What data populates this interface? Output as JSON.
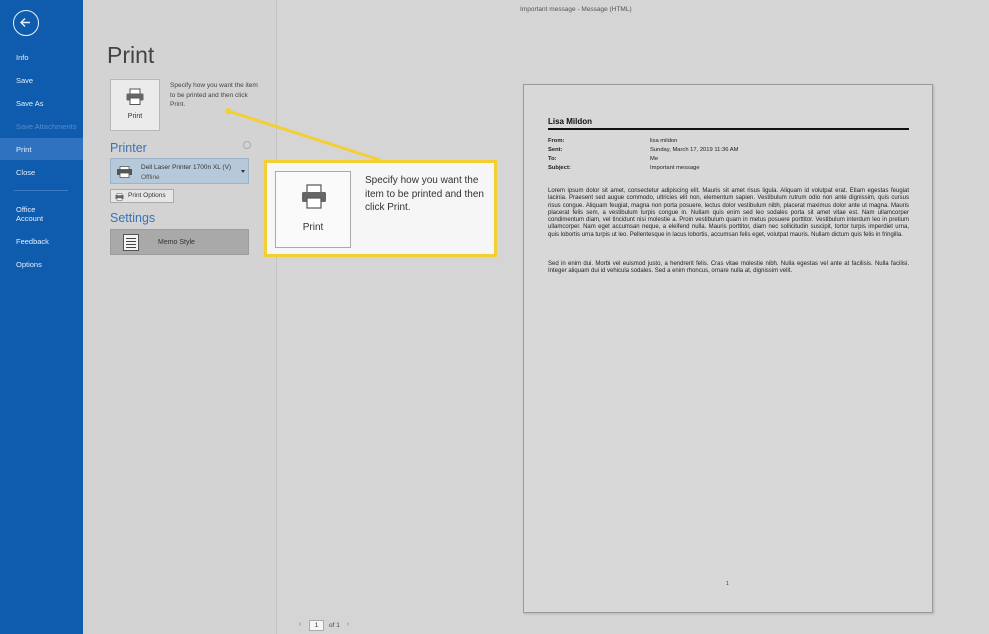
{
  "window": {
    "title": "Important message - Message (HTML)"
  },
  "sidebar": {
    "items": [
      {
        "label": "Info"
      },
      {
        "label": "Save"
      },
      {
        "label": "Save As"
      },
      {
        "label": "Save Attachments"
      },
      {
        "label": "Print"
      },
      {
        "label": "Close"
      },
      {
        "label": "Office Account"
      },
      {
        "label": "Feedback"
      },
      {
        "label": "Options"
      }
    ]
  },
  "print": {
    "title": "Print",
    "button_label": "Print",
    "description": "Specify how you want the item to be printed and then click Print."
  },
  "printer": {
    "heading": "Printer",
    "selected_name": "Dell Laser Printer 1700n XL (V)",
    "status": "Offline",
    "options_label": "Print Options"
  },
  "settings": {
    "heading": "Settings",
    "style_label": "Memo Style"
  },
  "preview": {
    "sender": "Lisa Mildon",
    "headers": [
      {
        "key": "From:",
        "value": "lisa mildon"
      },
      {
        "key": "Sent:",
        "value": "Sunday, March 17, 2019 11:36 AM"
      },
      {
        "key": "To:",
        "value": "Me"
      },
      {
        "key": "Subject:",
        "value": "Important message"
      }
    ],
    "body": [
      "Lorem ipsum dolor sit amet, consectetur adipiscing elit. Mauris sit amet risus ligula. Aliquam id volutpat erat. Etiam egestas feugiat lacinia. Praesent sed augue commodo, ultricies elit non, elementum sapien. Vestibulum rutrum odio non ante dignissim, quis cursus risus congue. Aliquam feugiat, magna non porta posuere, lectus dolor vestibulum nibh, placerat maximus dolor ante ut magna. Mauris placerat felis sem, a vestibulum turpis congue in. Nullam quis enim sed leo sodales porta sit amet vitae est. Nam ullamcorper condimentum diam, vel tincidunt nisi molestie a. Proin vestibulum quam in metus posuere porttitor. Vestibulum interdum leo in pretium ullamcorper. Nam eget accumsan neque, a eleifend nulla. Mauris porttitor, diam nec sollicitudin suscipit, tortor turpis imperdiet urna, quis lobortis urna turpis ut leo. Pellentesque in lacus lobortis, accumsan felis eget, volutpat mauris. Nullam dictum quis felis in fringilla.",
      "Sed in enim dui. Morbi vel euismod justo, a hendrerit felis. Cras vitae molestie nibh. Nulla egestas vel ante at facilisis. Nulla facilisi. Integer aliquam dui id vehicula sodales. Sed a enim rhoncus, ornare nulla at, dignissim velit."
    ],
    "page_number": "1"
  },
  "pager": {
    "current": "1",
    "total_label": "of 1"
  },
  "callout": {
    "button_label": "Print",
    "text": "Specify how you want the item to be printed and then click Print.",
    "color": "#f3cf34"
  },
  "colors": {
    "sidebar": "#0f5cae",
    "accent": "#3a72b8"
  }
}
